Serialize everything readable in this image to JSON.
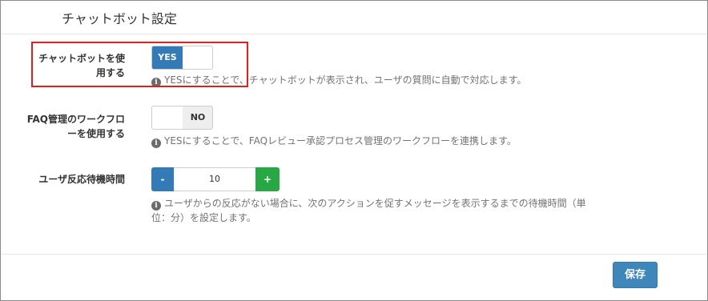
{
  "panel": {
    "title": "チャットボット設定"
  },
  "settings": {
    "chatbot": {
      "label_line1": "チャットボットを使",
      "label_line2": "用する",
      "toggle_on": "YES",
      "help": "YESにすることで、チャットボットが表示され、ユーザの質問に自動で対応します。"
    },
    "faq_workflow": {
      "label_line1": "FAQ管理のワークフロ",
      "label_line2": "ーを使用する",
      "toggle_off": "NO",
      "help": "YESにすることで、FAQレビュー承認プロセス管理のワークフローを連携します。"
    },
    "wait_time": {
      "label": "ユーザ反応待機時間",
      "minus": "-",
      "value": "10",
      "plus": "+",
      "help_line1": "ユーザからの反応がない場合に、次のアクションを促すメッセージを表示するまでの待機時間（単",
      "help_line2": "位：分）を設定します。"
    }
  },
  "info_icon_glyph": "i",
  "footer": {
    "save_label": "保存"
  },
  "colors": {
    "primary": "#337ab7",
    "success": "#27a844",
    "highlight": "#e02020"
  }
}
